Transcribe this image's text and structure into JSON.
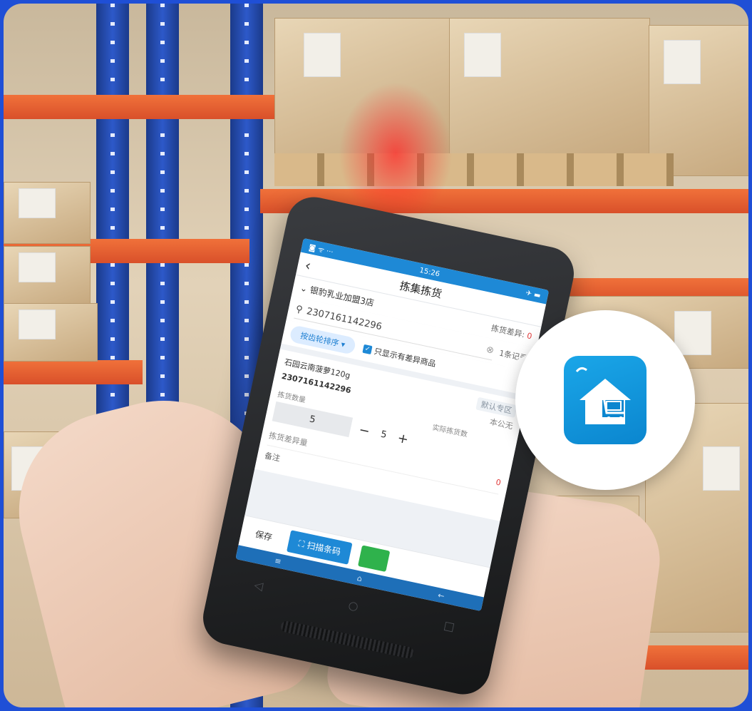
{
  "app": {
    "status_time": "15:26",
    "title": "拣集拣货",
    "back_icon": "chevron-left-icon"
  },
  "store": {
    "name": "银豹乳业加盟3店",
    "diff_label": "拣货差异:",
    "diff_value": "0"
  },
  "search": {
    "value": "2307161142296",
    "count": "1条记录",
    "icon": "search-icon",
    "clear_icon": "clear-icon"
  },
  "filter": {
    "sort_label": "按齿轮排序 ▾",
    "only_diff_label": "只显示有差异商品",
    "only_diff_checked": true
  },
  "item": {
    "name": "石园云南菠萝120g",
    "zone": "默认专区",
    "sku": "2307161142296",
    "location": "本公无",
    "plan_qty_label": "拣货数量",
    "actual_qty_label": "实际拣货数",
    "plan_qty": "5",
    "actual_qty": "5",
    "minus": "−",
    "plus": "+",
    "reason_label": "拣货差异量",
    "reason_value": "0",
    "remark_label": "备注"
  },
  "bottom": {
    "save_label": "保存",
    "scan_label": "扫描条码",
    "scan_icon": "scan-icon"
  },
  "navbar": {
    "menu_icon": "≡",
    "home_icon": "⌂",
    "back_icon": "←"
  },
  "hardware_keys": [
    "◁",
    "○",
    "□"
  ],
  "callout": {
    "icon": "store-cart-icon",
    "colors": {
      "bg": "#0b86cf",
      "accent": "#ffffff"
    }
  },
  "colors": {
    "border_frame": "#1f4fd6",
    "primary": "#1e89d6",
    "confirm": "#2fb24c",
    "shelf_orange": "#e85f2f",
    "upright_blue": "#2d59c9"
  }
}
